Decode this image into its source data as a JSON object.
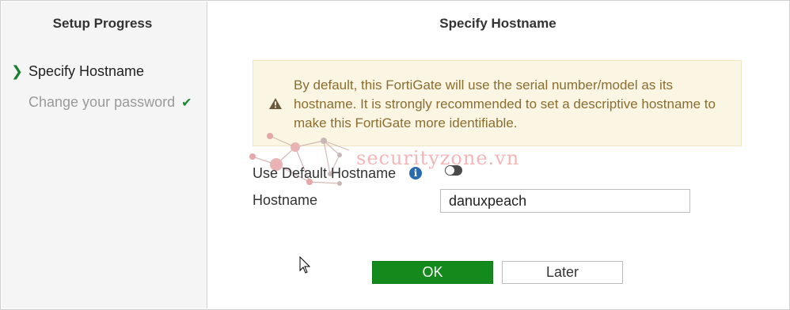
{
  "sidebar": {
    "title": "Setup Progress",
    "steps": [
      {
        "label": "Specify Hostname",
        "state": "current"
      },
      {
        "label": "Change your password",
        "state": "done"
      }
    ]
  },
  "main": {
    "title": "Specify Hostname",
    "warning": {
      "icon": "warning-triangle-icon",
      "text": "By default, this FortiGate will use the serial number/model as its hostname. It is strongly recommended to set a descriptive hostname to make this FortiGate more identifiable."
    },
    "use_default_hostname": {
      "label": "Use Default Hostname",
      "info_icon": "info-icon",
      "enabled": false
    },
    "hostname": {
      "label": "Hostname",
      "value": "danuxpeach"
    },
    "buttons": {
      "ok": "OK",
      "later": "Later"
    }
  },
  "watermark": {
    "text": "securityzone.vn"
  },
  "colors": {
    "ok_button": "#138a1b",
    "warning_bg": "#fbf5e3",
    "warning_text": "#8a6e2f",
    "sidebar_bg": "#f5f5f5",
    "check": "#1b8a2e"
  }
}
